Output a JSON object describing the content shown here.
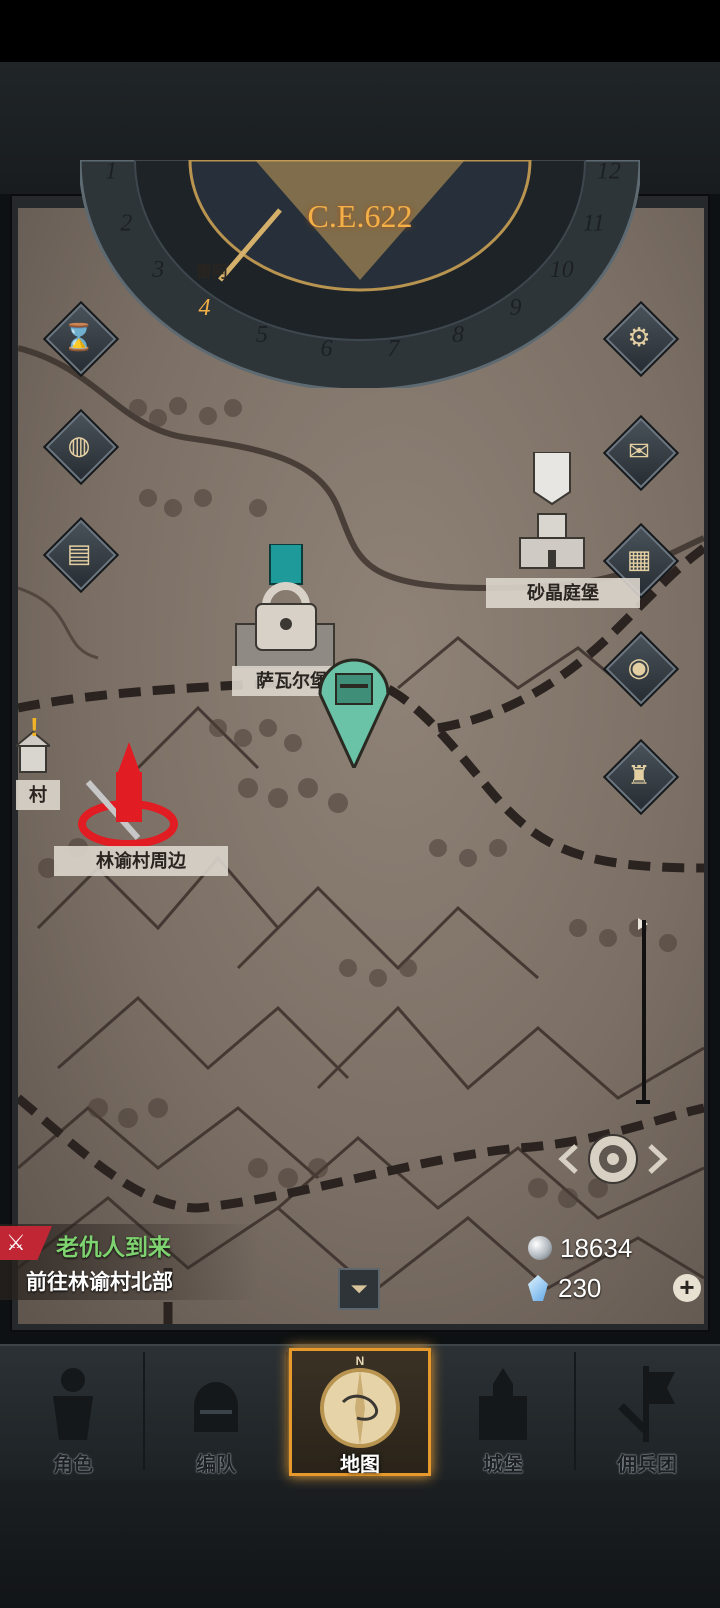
{
  "dial": {
    "year": "C.E.622",
    "months": [
      "1",
      "2",
      "3",
      "4",
      "5",
      "6",
      "7",
      "8",
      "9",
      "10",
      "11",
      "12"
    ],
    "current_month": "4",
    "partial_label": "雷阿"
  },
  "side_buttons_left": [
    {
      "name": "hourglass",
      "icon": "hourglass-icon",
      "glyph": "⌛"
    },
    {
      "name": "bag",
      "icon": "money-bag-icon",
      "glyph": "💰"
    },
    {
      "name": "scroll",
      "icon": "scroll-icon",
      "glyph": "📜"
    }
  ],
  "side_buttons_right": [
    {
      "name": "settings",
      "icon": "gear-icon",
      "glyph": "⚙"
    },
    {
      "name": "mail",
      "icon": "mail-icon",
      "glyph": "✉"
    },
    {
      "name": "board",
      "icon": "board-icon",
      "glyph": "▦"
    },
    {
      "name": "coin",
      "icon": "coin-stack-icon",
      "glyph": "◉"
    },
    {
      "name": "helmet",
      "icon": "soldier-icon",
      "glyph": "♜"
    }
  ],
  "locations": {
    "sand_crystal": "砂晶庭堡",
    "savar": "萨瓦尔堡",
    "linyu_outskirts": "林谕村周边",
    "village_partial": "村",
    "alert": "!"
  },
  "quest": {
    "title": "老仇人到来",
    "subtitle": "前往林谕村北部"
  },
  "resources": {
    "silver": "18634",
    "crystal": "230",
    "plus": "+"
  },
  "nav": {
    "compass_n": "N",
    "items": [
      {
        "label": "角色",
        "icon": "knight-icon",
        "active": false
      },
      {
        "label": "编队",
        "icon": "helmet-icon",
        "active": false
      },
      {
        "label": "地图",
        "icon": "compass-map-icon",
        "active": true
      },
      {
        "label": "城堡",
        "icon": "castle-icon",
        "active": false
      },
      {
        "label": "佣兵团",
        "icon": "banner-icon",
        "active": false
      }
    ]
  },
  "colors": {
    "accent": "#f4b046",
    "quest_green": "#7ed26f",
    "quest_red": "#c12635",
    "map_parchment": "#8f8276"
  }
}
